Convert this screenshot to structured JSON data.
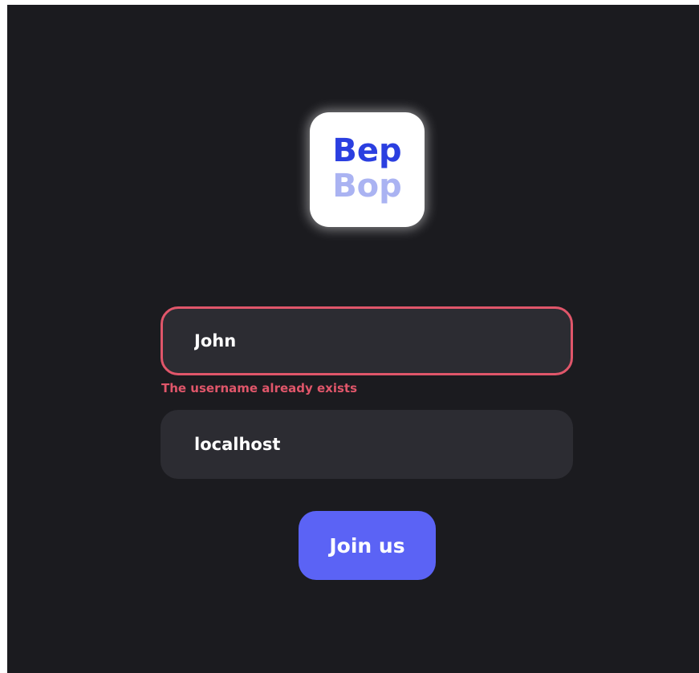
{
  "logo": {
    "line1": "Bep",
    "line2": "Bop",
    "colors": {
      "line1": "#2b3fe0",
      "line2": "#aab3f2",
      "background": "#ffffff"
    }
  },
  "form": {
    "username": {
      "value": "John",
      "error": "The username already exists"
    },
    "server": {
      "value": "localhost"
    },
    "submit_label": "Join us"
  },
  "colors": {
    "background": "#1b1b1f",
    "field_background": "#2c2c32",
    "error": "#e0566a",
    "accent": "#5b63f5"
  }
}
